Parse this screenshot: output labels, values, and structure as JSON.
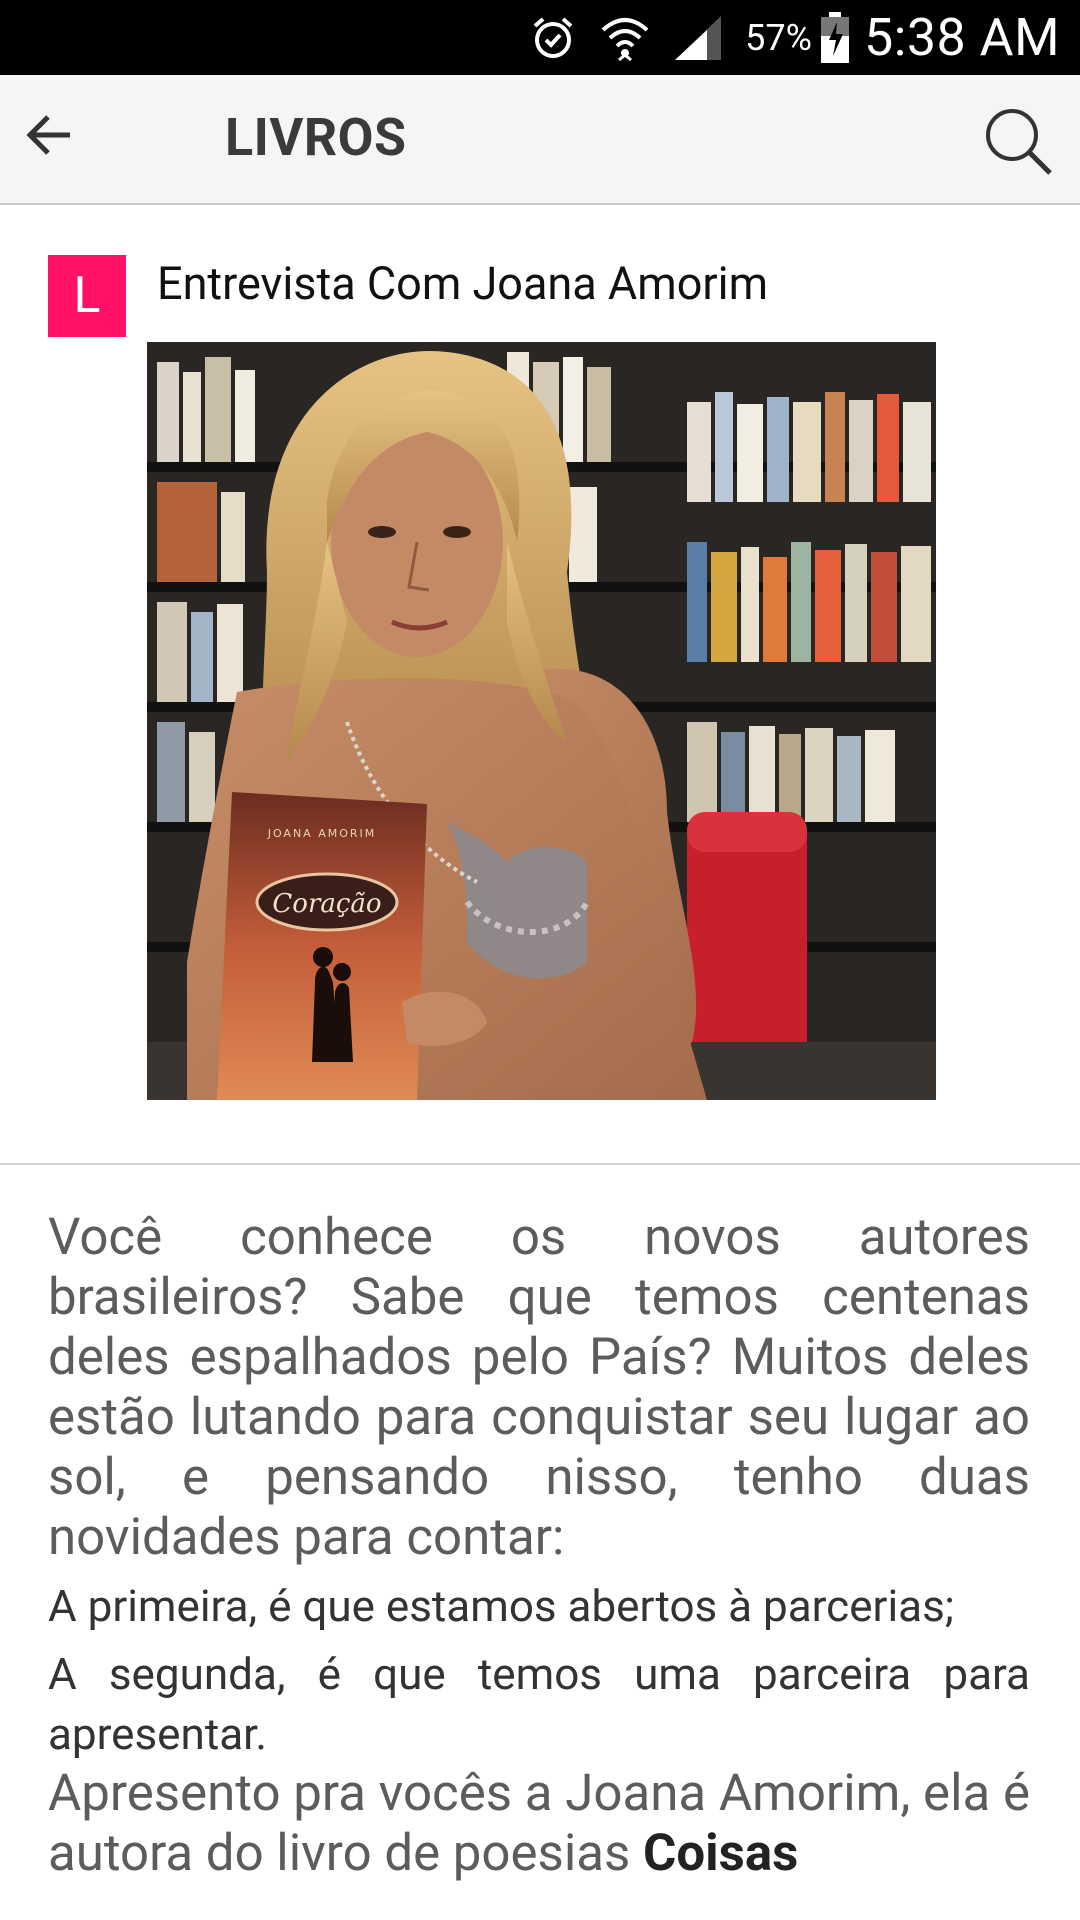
{
  "status_bar": {
    "battery": "57%",
    "time": "5:38 AM"
  },
  "app_bar": {
    "title": "LIVROS"
  },
  "post": {
    "badge_letter": "L",
    "title": "Entrevista Com Joana Amorim",
    "photo_book_title": "Coração",
    "photo_book_author": "JOANA AMORIM"
  },
  "article": {
    "paragraph1": "Você conhece os novos autores brasileiros? Sabe que temos centenas deles espalhados pelo País? Muitos deles estão lutando para conquistar seu lugar ao sol, e pensando nisso, tenho duas novidades para contar:",
    "paragraph2": "A primeira, é que estamos abertos à parcerias;",
    "paragraph3": "A segunda, é que temos uma parceira para apresentar.",
    "paragraph4_start": "Apresento pra vocês a Joana Amorim, ela é autora do livro de poesias ",
    "paragraph4_bold": "Coisas"
  },
  "colors": {
    "badge": "#ff1168",
    "status_bar": "#000000",
    "app_bar": "#f5f5f5"
  },
  "icons": [
    "alarm-icon",
    "wifi-icon",
    "signal-icon",
    "battery-icon",
    "back-arrow-icon",
    "search-icon"
  ]
}
